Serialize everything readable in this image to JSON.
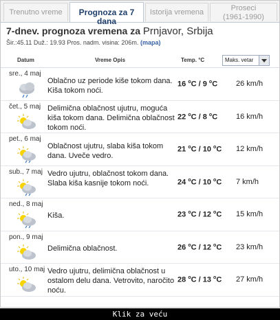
{
  "tabs": [
    {
      "label": "Trenutno vreme",
      "active": false
    },
    {
      "label": "Prognoza za 7 dana",
      "active": true
    },
    {
      "label": "Istorija vremena",
      "active": false
    },
    {
      "label": "Proseci",
      "sub": "(1961-1990)",
      "active": false
    }
  ],
  "header": {
    "title_prefix": "7-dnev. prognoza vremena za",
    "place": "Prnjavor, Srbija",
    "coords": "Šir.:45.11 Duž.: 19.93 Pros. nadm. visina: 206m.",
    "map_link": "(mapa)"
  },
  "table": {
    "col_date": "Datum",
    "col_desc": "Vreme Opis",
    "col_temp": "Temp. °C",
    "wind_select": "Maks. vetar",
    "rows": [
      {
        "date": "sre., 4 maj",
        "icon": "cloud-rain-icon",
        "desc": "Oblačno uz periode kiše tokom dana. Kiša tokom noći.",
        "hi": "16",
        "lo": "9",
        "wind": "26 km/h"
      },
      {
        "date": "čet., 5 maj",
        "icon": "sun-cloud-icon",
        "desc": "Delimična oblačnost ujutru, moguća kiša tokom dana. Delimična oblačnost tokom noći.",
        "hi": "22",
        "lo": "8",
        "wind": "16 km/h"
      },
      {
        "date": "pet., 6 maj",
        "icon": "sun-cloud-rain-icon",
        "desc": "Oblačnost ujutru, slaba kiša tokom dana. Uveče vedro.",
        "hi": "21",
        "lo": "10",
        "wind": "12 km/h"
      },
      {
        "date": "sub., 7 maj",
        "icon": "sun-cloud-rain-icon",
        "desc": "Vedro ujutru, oblačnost tokom dana. Slaba kiša kasnije tokom noći.",
        "hi": "24",
        "lo": "10",
        "wind": "7 km/h"
      },
      {
        "date": "ned., 8 maj",
        "icon": "sun-cloud-rain-icon",
        "desc": "Kiša.",
        "hi": "23",
        "lo": "12",
        "wind": "15 km/h"
      },
      {
        "date": "pon., 9 maj",
        "icon": "sun-cloud-icon",
        "desc": "Delimična oblačnost.",
        "hi": "26",
        "lo": "12",
        "wind": "23 km/h"
      },
      {
        "date": "uto., 10 maj",
        "icon": "sun-cloud-icon",
        "desc": "Vedro ujutru, delimična oblačnost u ostalom delu dana. Vetrovito, naročito noću.",
        "hi": "28",
        "lo": "13",
        "wind": "27 km/h"
      }
    ]
  },
  "caption": "Klik za veću"
}
